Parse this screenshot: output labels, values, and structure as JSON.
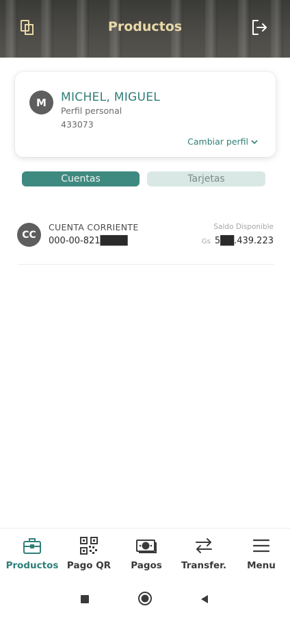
{
  "header": {
    "title": "Productos",
    "left_icon": "documents-icon",
    "right_icon": "logout-icon"
  },
  "profile": {
    "initial": "M",
    "name": "MICHEL, MIGUEL",
    "type": "Perfil personal",
    "id": "433073",
    "change_label": "Cambiar perfil"
  },
  "tabs": [
    {
      "label": "Cuentas",
      "active": true
    },
    {
      "label": "Tarjetas",
      "active": false
    }
  ],
  "account": {
    "badge": "CC",
    "type": "CUENTA CORRIENTE",
    "number": "000-00-821████",
    "balance_label": "Saldo Disponible",
    "currency": "Gs",
    "balance": "5██.439.223"
  },
  "bottom_nav": [
    {
      "label": "Productos",
      "icon": "briefcase-icon",
      "active": true
    },
    {
      "label": "Pago QR",
      "icon": "qr-code-icon",
      "active": false
    },
    {
      "label": "Pagos",
      "icon": "cash-icon",
      "active": false
    },
    {
      "label": "Transfer.",
      "icon": "transfer-arrows-icon",
      "active": false
    },
    {
      "label": "Menu",
      "icon": "hamburger-menu-icon",
      "active": false
    }
  ],
  "colors": {
    "accent": "#2e7f78",
    "header_title": "#e8d9a8",
    "tab_active": "#3f8a80",
    "tab_inactive": "#d9e8e5"
  }
}
